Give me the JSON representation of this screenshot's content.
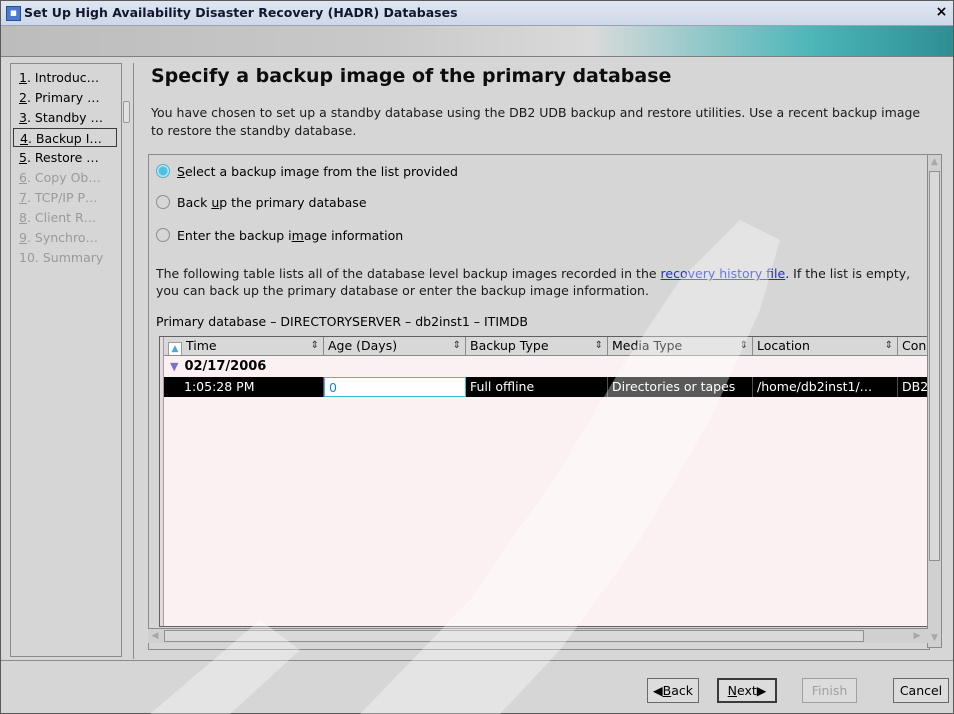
{
  "window": {
    "title": "Set Up High Availability Disaster Recovery (HADR) Databases",
    "close_glyph": "×"
  },
  "sidebar": {
    "items": [
      {
        "num": "1",
        "label": ". Introduc…",
        "state": "enabled"
      },
      {
        "num": "2",
        "label": ". Primary …",
        "state": "enabled"
      },
      {
        "num": "3",
        "label": ". Standby …",
        "state": "enabled"
      },
      {
        "num": "4",
        "label": ". Backup I…",
        "state": "selected"
      },
      {
        "num": "5",
        "label": ". Restore …",
        "state": "enabled"
      },
      {
        "num": "6",
        "label": ". Copy Ob…",
        "state": "disabled"
      },
      {
        "num": "7",
        "label": ". TCP/IP P…",
        "state": "disabled"
      },
      {
        "num": "8",
        "label": ". Client R…",
        "state": "disabled"
      },
      {
        "num": "9",
        "label": ". Synchro…",
        "state": "disabled"
      },
      {
        "num": "",
        "label": "10. Summary",
        "state": "disabled"
      }
    ]
  },
  "main": {
    "heading": "Specify a backup image of the primary database",
    "description": "You have chosen to set up a standby database using the DB2 UDB backup and restore utilities. Use a recent backup image to restore the standby database.",
    "options": {
      "select": {
        "pre": "",
        "mnemonic": "S",
        "post": "elect a backup image from the list provided",
        "selected": true
      },
      "backup": {
        "pre": "Back ",
        "mnemonic": "u",
        "post": "p the primary database",
        "selected": false
      },
      "enter": {
        "pre": "Enter the backup i",
        "mnemonic": "m",
        "post": "age information",
        "selected": false
      }
    },
    "info_before": "The following table lists all of the database level backup images recorded in the ",
    "info_link": "recovery history file",
    "info_after": ". If the list is empty, you can back up the primary database or enter the backup image information.",
    "primary_db": "Primary database – DIRECTORYSERVER – db2inst1 – ITIMDB",
    "table": {
      "columns": [
        "Time",
        "Age (Days)",
        "Backup Type",
        "Media Type",
        "Location",
        "Con"
      ],
      "group_date": "02/17/2006",
      "row": {
        "time": "1:05:28 PM",
        "age": "0",
        "backup_type": "Full offline",
        "media_type": "Directories or tapes",
        "location": "/home/db2inst1/…",
        "con": "DB2"
      }
    }
  },
  "footer": {
    "back": {
      "mnemonic": "B",
      "rest": "ack"
    },
    "next": {
      "mnemonic": "N",
      "rest": "ext"
    },
    "finish": "Finish",
    "cancel": "Cancel"
  },
  "colors": {
    "selected_row": "#000000",
    "table_bg": "#fbf1f3",
    "link": "#1a2fd0"
  }
}
